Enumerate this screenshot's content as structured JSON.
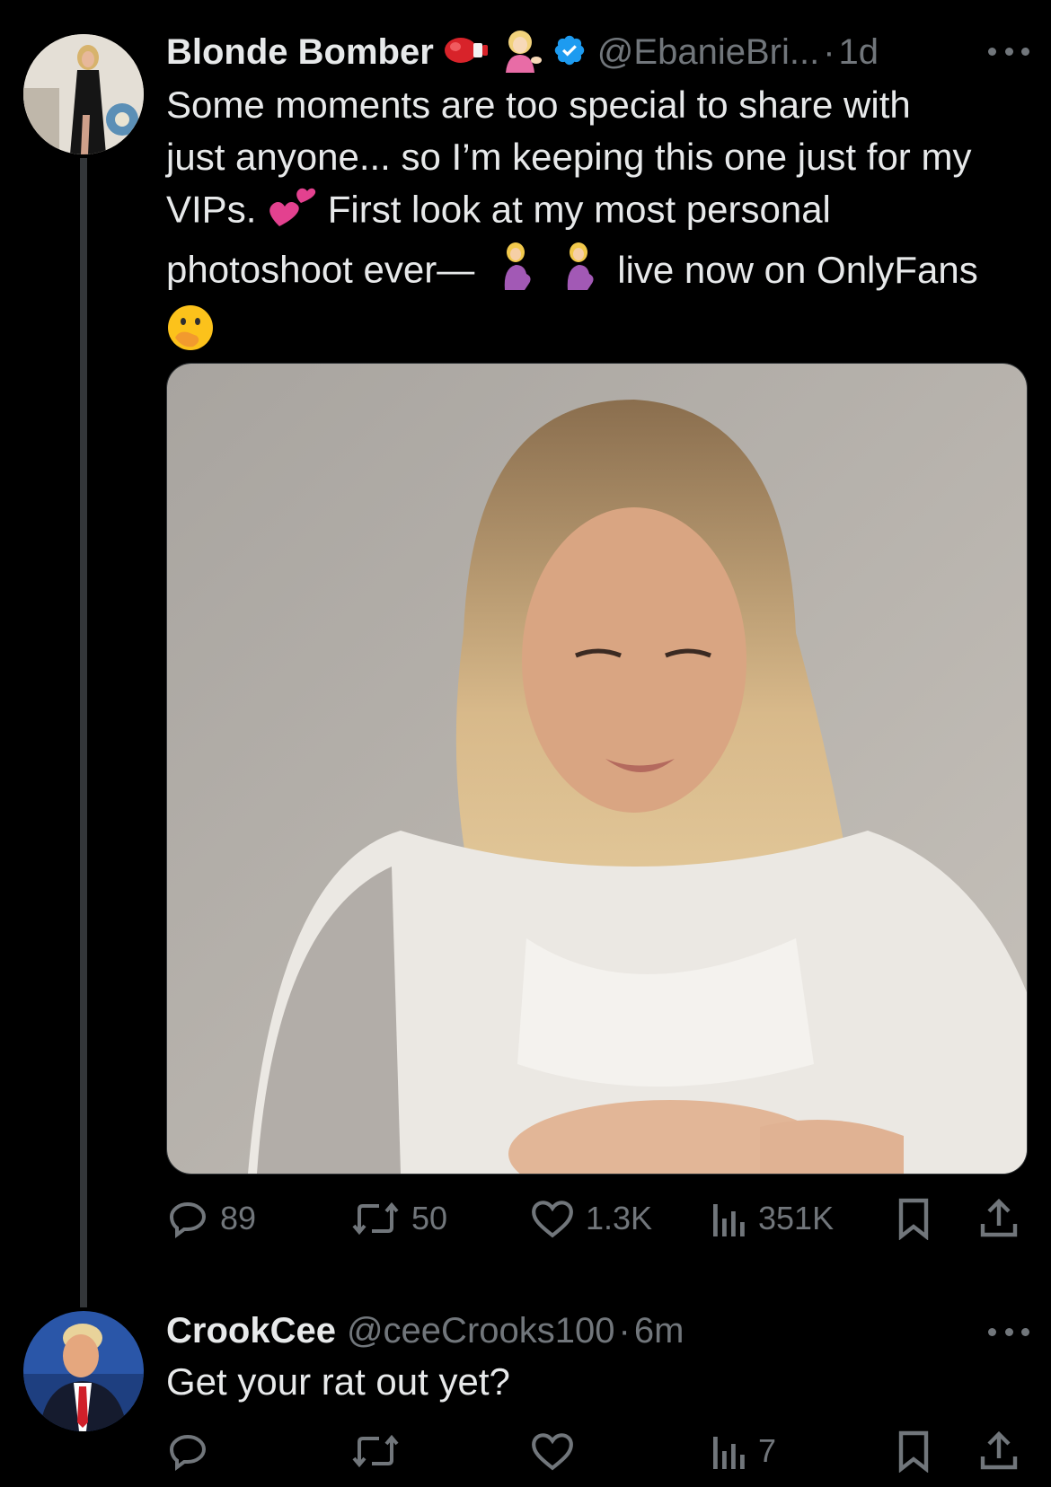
{
  "tweet1": {
    "name": "Blonde Bomber",
    "name_emojis": [
      "boxing-glove",
      "woman-tipping-hand"
    ],
    "handle": "@EbanieBri...",
    "separator": "·",
    "time": "1d",
    "text_line1": "Some moments are too special to share with",
    "text_line2": "just anyone... so I’m keeping this one just for my",
    "text_line3a": "VIPs.",
    "text_line3b": "First look at my most personal",
    "text_line4a": "photoshoot ever—",
    "text_line4b": "live now on OnlyFans",
    "text_emojis": [
      "two-hearts",
      "pregnant-woman",
      "pregnant-woman",
      "face-with-hand-over-mouth"
    ],
    "actions": {
      "replies": "89",
      "reposts": "50",
      "likes": "1.3K",
      "views": "351K"
    }
  },
  "tweet2": {
    "name": "CrookCee",
    "handle": "@ceeCrooks100",
    "separator": "·",
    "time": "6m",
    "text": "Get your rat out yet?",
    "actions": {
      "replies": "",
      "reposts": "",
      "likes": "",
      "views": "7"
    }
  },
  "colors": {
    "background": "#000000",
    "text": "#e7e9ea",
    "secondary": "#71767b",
    "verified": "#1d9bf0",
    "thread_line": "#333639"
  }
}
